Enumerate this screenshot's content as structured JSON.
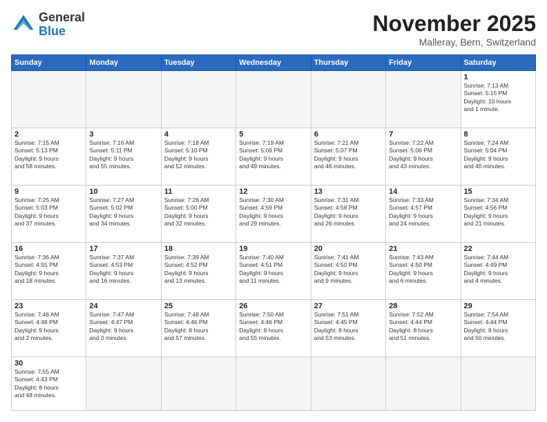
{
  "header": {
    "logo_general": "General",
    "logo_blue": "Blue",
    "month_title": "November 2025",
    "location": "Malleray, Bern, Switzerland"
  },
  "weekdays": [
    "Sunday",
    "Monday",
    "Tuesday",
    "Wednesday",
    "Thursday",
    "Friday",
    "Saturday"
  ],
  "days": {
    "1": {
      "num": "1",
      "info": "Sunrise: 7:13 AM\nSunset: 5:15 PM\nDaylight: 10 hours\nand 1 minute."
    },
    "2": {
      "num": "2",
      "info": "Sunrise: 7:15 AM\nSunset: 5:13 PM\nDaylight: 9 hours\nand 58 minutes."
    },
    "3": {
      "num": "3",
      "info": "Sunrise: 7:16 AM\nSunset: 5:11 PM\nDaylight: 9 hours\nand 55 minutes."
    },
    "4": {
      "num": "4",
      "info": "Sunrise: 7:18 AM\nSunset: 5:10 PM\nDaylight: 9 hours\nand 52 minutes."
    },
    "5": {
      "num": "5",
      "info": "Sunrise: 7:19 AM\nSunset: 5:09 PM\nDaylight: 9 hours\nand 49 minutes."
    },
    "6": {
      "num": "6",
      "info": "Sunrise: 7:21 AM\nSunset: 5:07 PM\nDaylight: 9 hours\nand 46 minutes."
    },
    "7": {
      "num": "7",
      "info": "Sunrise: 7:22 AM\nSunset: 5:06 PM\nDaylight: 9 hours\nand 43 minutes."
    },
    "8": {
      "num": "8",
      "info": "Sunrise: 7:24 AM\nSunset: 5:04 PM\nDaylight: 9 hours\nand 40 minutes."
    },
    "9": {
      "num": "9",
      "info": "Sunrise: 7:25 AM\nSunset: 5:03 PM\nDaylight: 9 hours\nand 37 minutes."
    },
    "10": {
      "num": "10",
      "info": "Sunrise: 7:27 AM\nSunset: 5:02 PM\nDaylight: 9 hours\nand 34 minutes."
    },
    "11": {
      "num": "11",
      "info": "Sunrise: 7:28 AM\nSunset: 5:00 PM\nDaylight: 9 hours\nand 32 minutes."
    },
    "12": {
      "num": "12",
      "info": "Sunrise: 7:30 AM\nSunset: 4:59 PM\nDaylight: 9 hours\nand 29 minutes."
    },
    "13": {
      "num": "13",
      "info": "Sunrise: 7:31 AM\nSunset: 4:58 PM\nDaylight: 9 hours\nand 26 minutes."
    },
    "14": {
      "num": "14",
      "info": "Sunrise: 7:33 AM\nSunset: 4:57 PM\nDaylight: 9 hours\nand 24 minutes."
    },
    "15": {
      "num": "15",
      "info": "Sunrise: 7:34 AM\nSunset: 4:56 PM\nDaylight: 9 hours\nand 21 minutes."
    },
    "16": {
      "num": "16",
      "info": "Sunrise: 7:36 AM\nSunset: 4:55 PM\nDaylight: 9 hours\nand 18 minutes."
    },
    "17": {
      "num": "17",
      "info": "Sunrise: 7:37 AM\nSunset: 4:53 PM\nDaylight: 9 hours\nand 16 minutes."
    },
    "18": {
      "num": "18",
      "info": "Sunrise: 7:39 AM\nSunset: 4:52 PM\nDaylight: 9 hours\nand 13 minutes."
    },
    "19": {
      "num": "19",
      "info": "Sunrise: 7:40 AM\nSunset: 4:51 PM\nDaylight: 9 hours\nand 11 minutes."
    },
    "20": {
      "num": "20",
      "info": "Sunrise: 7:41 AM\nSunset: 4:50 PM\nDaylight: 9 hours\nand 9 minutes."
    },
    "21": {
      "num": "21",
      "info": "Sunrise: 7:43 AM\nSunset: 4:50 PM\nDaylight: 9 hours\nand 6 minutes."
    },
    "22": {
      "num": "22",
      "info": "Sunrise: 7:44 AM\nSunset: 4:49 PM\nDaylight: 9 hours\nand 4 minutes."
    },
    "23": {
      "num": "23",
      "info": "Sunrise: 7:46 AM\nSunset: 4:48 PM\nDaylight: 9 hours\nand 2 minutes."
    },
    "24": {
      "num": "24",
      "info": "Sunrise: 7:47 AM\nSunset: 4:47 PM\nDaylight: 9 hours\nand 0 minutes."
    },
    "25": {
      "num": "25",
      "info": "Sunrise: 7:48 AM\nSunset: 4:46 PM\nDaylight: 8 hours\nand 57 minutes."
    },
    "26": {
      "num": "26",
      "info": "Sunrise: 7:50 AM\nSunset: 4:46 PM\nDaylight: 8 hours\nand 55 minutes."
    },
    "27": {
      "num": "27",
      "info": "Sunrise: 7:51 AM\nSunset: 4:45 PM\nDaylight: 8 hours\nand 53 minutes."
    },
    "28": {
      "num": "28",
      "info": "Sunrise: 7:52 AM\nSunset: 4:44 PM\nDaylight: 8 hours\nand 51 minutes."
    },
    "29": {
      "num": "29",
      "info": "Sunrise: 7:54 AM\nSunset: 4:44 PM\nDaylight: 8 hours\nand 50 minutes."
    },
    "30": {
      "num": "30",
      "info": "Sunrise: 7:55 AM\nSunset: 4:43 PM\nDaylight: 8 hours\nand 48 minutes."
    }
  }
}
